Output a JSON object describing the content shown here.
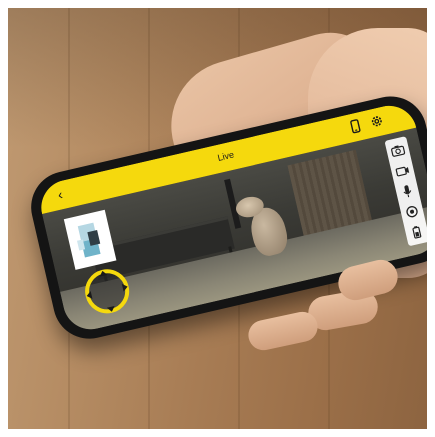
{
  "app": {
    "screen_title": "Live",
    "back_glyph": "‹",
    "topbar_icons": [
      "phone-icon",
      "settings-gear-icon"
    ],
    "side_controls": [
      "camera-snapshot-icon",
      "video-record-icon",
      "microphone-icon",
      "treat-dispense-icon",
      "battery-icon"
    ],
    "joystick": "direction-joystick"
  },
  "colors": {
    "accent_yellow": "#f5d90d",
    "phone_body": "#141414",
    "sidebar_bg": "#ffffff"
  }
}
